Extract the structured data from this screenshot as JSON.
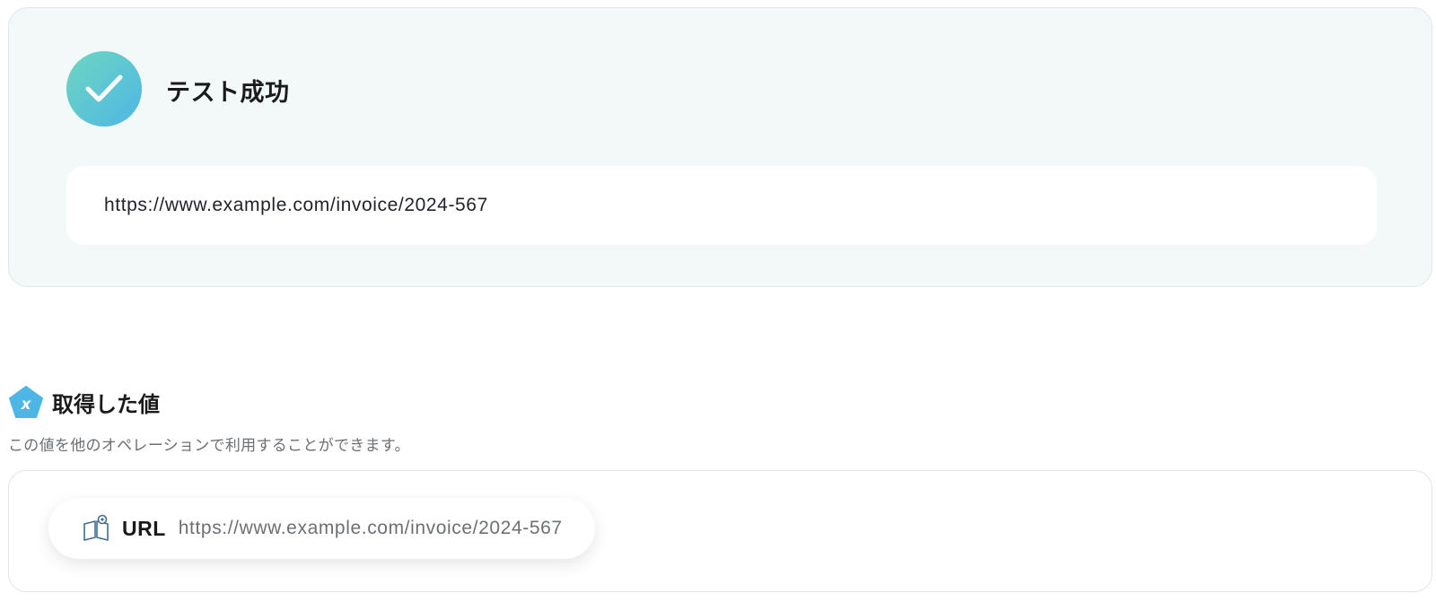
{
  "test_result": {
    "status_icon": "check-icon",
    "title": "テスト成功",
    "output_value": "https://www.example.com/invoice/2024-567"
  },
  "acquired_values": {
    "icon": "variable-pentagon-icon",
    "title": "取得した値",
    "description": "この値を他のオペレーションで利用することができます。",
    "items": [
      {
        "icon": "book-icon",
        "label": "URL",
        "value": "https://www.example.com/invoice/2024-567"
      }
    ]
  },
  "colors": {
    "success_gradient_start": "#6fd6c1",
    "success_gradient_end": "#4db6e4",
    "panel_background": "#f3f9f9",
    "accent": "#4db6e4"
  }
}
